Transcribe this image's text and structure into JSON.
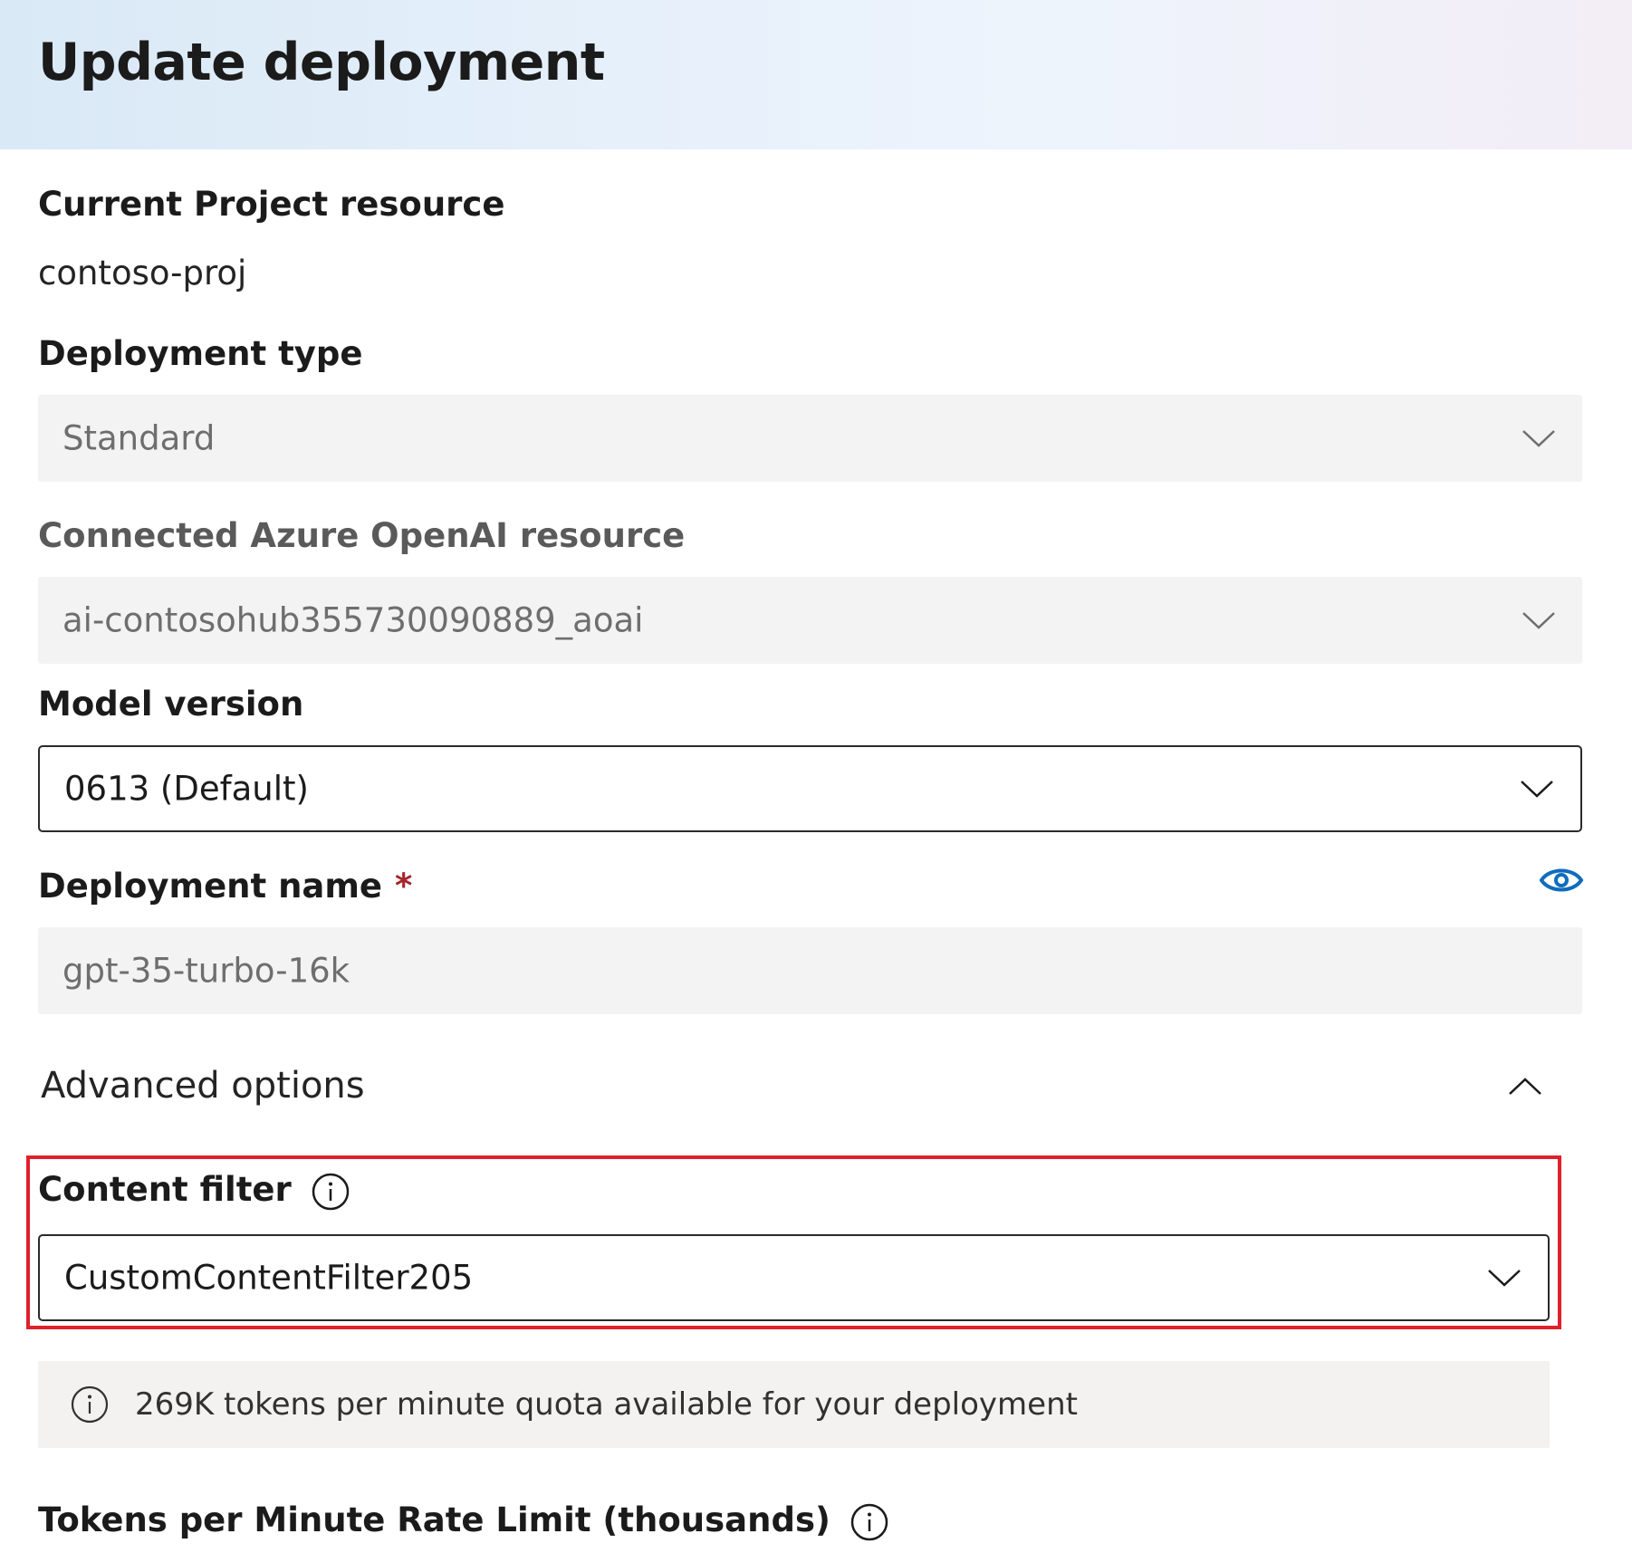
{
  "header": {
    "title": "Update deployment"
  },
  "project": {
    "label": "Current Project resource",
    "value": "contoso-proj"
  },
  "deployment_type": {
    "label": "Deployment type",
    "value": "Standard"
  },
  "openai_resource": {
    "label": "Connected Azure OpenAI resource",
    "value": "ai-contosohub355730090889_aoai"
  },
  "model_version": {
    "label": "Model version",
    "value": "0613 (Default)"
  },
  "deployment_name": {
    "label": "Deployment name",
    "required_marker": "*",
    "value": "gpt-35-turbo-16k"
  },
  "advanced": {
    "label": "Advanced options"
  },
  "content_filter": {
    "label": "Content filter",
    "value": "CustomContentFilter205"
  },
  "quota": {
    "message": "269K tokens per minute quota available for your deployment"
  },
  "rate_limit": {
    "label": "Tokens per Minute Rate Limit (thousands)"
  },
  "colors": {
    "accent": "#0f6cbd",
    "required": "#a4262c",
    "highlight": "#e0202c"
  }
}
